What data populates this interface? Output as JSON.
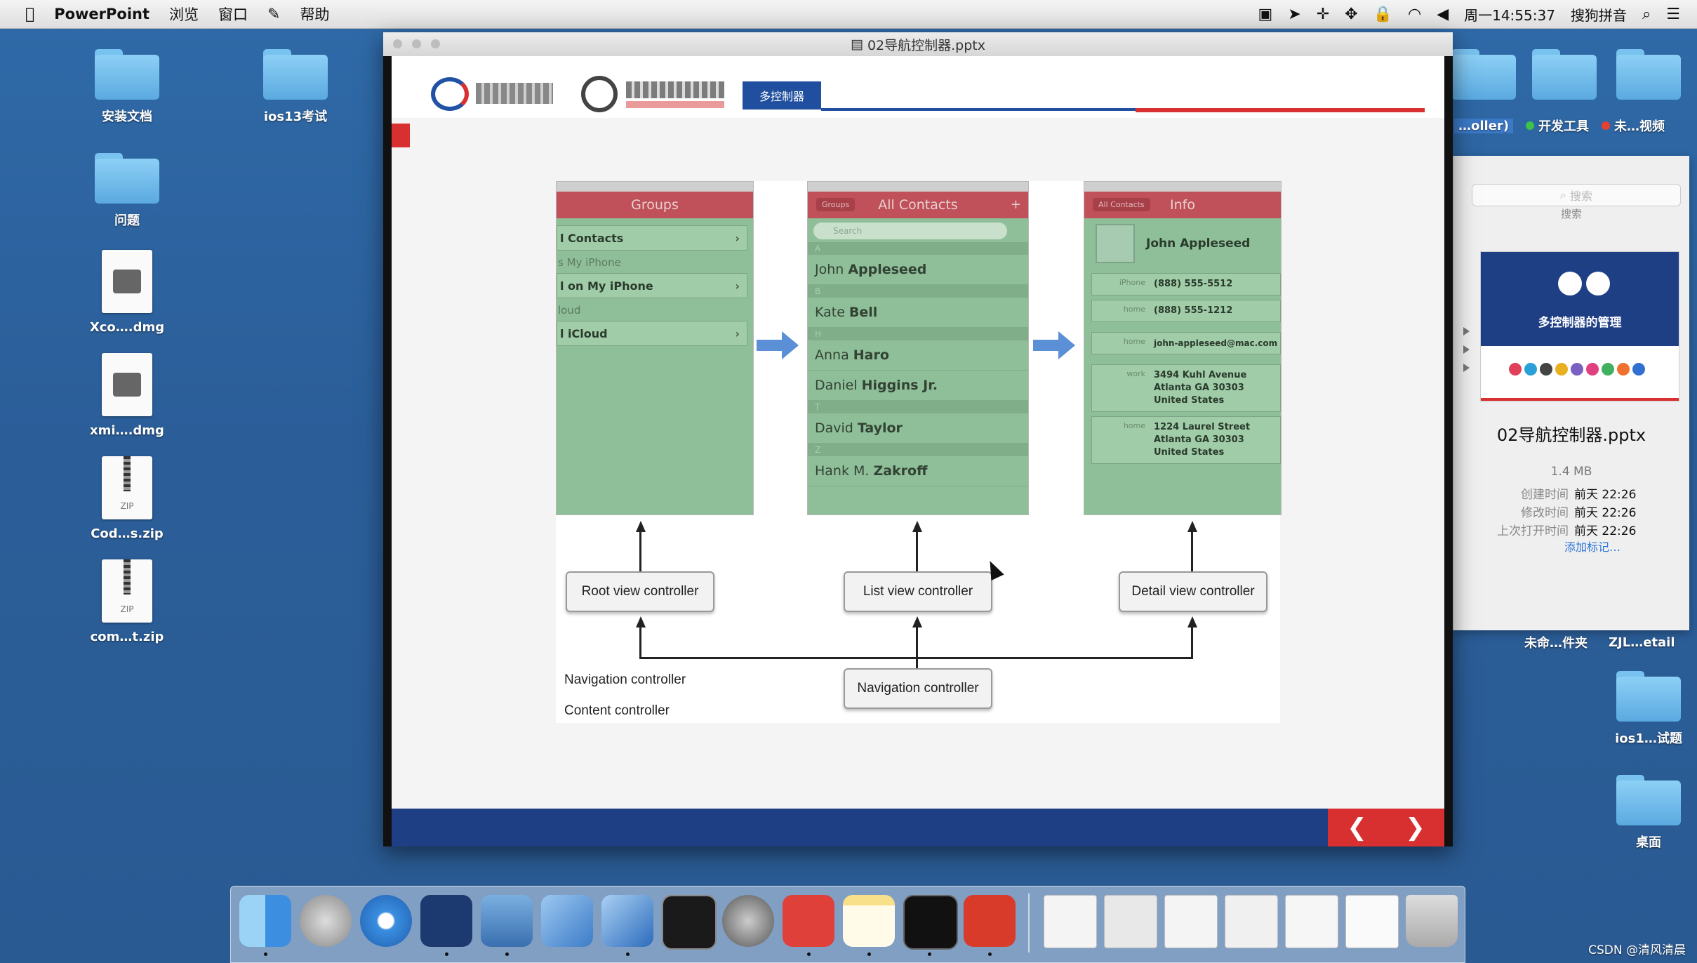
{
  "menubar": {
    "app_name": "PowerPoint",
    "menus": [
      "浏览",
      "窗口",
      "帮助"
    ],
    "clock": "周一14:55:37",
    "input_method": "搜狗拼音"
  },
  "desktop_left": [
    {
      "label": "安装文档",
      "kind": "folder"
    },
    {
      "label": "ios13考试",
      "kind": "folder"
    },
    {
      "label": "问题",
      "kind": "folder"
    },
    {
      "label": "Xco….dmg",
      "kind": "dmg"
    },
    {
      "label": "xmi….dmg",
      "kind": "dmg"
    },
    {
      "label": "Cod…s.zip",
      "kind": "zip"
    },
    {
      "label": "com…t.zip",
      "kind": "zip"
    }
  ],
  "desktop_right": {
    "tag_row": [
      {
        "label": "…oller)",
        "color": ""
      },
      {
        "label": "开发工具",
        "color": "#3dc24a"
      },
      {
        "label": "未…视频",
        "color": "#e8402f"
      }
    ],
    "row2": [
      "未命…件夹",
      "ZJL…etail"
    ],
    "items": [
      {
        "label": "ios1…试题"
      },
      {
        "label": "桌面"
      }
    ]
  },
  "window": {
    "title": "02导航控制器.pptx"
  },
  "slide": {
    "header_badge": "多控制器",
    "zip_text": "ZIP",
    "nav_prev": "❮",
    "nav_next": "❯",
    "groups_screen": {
      "title": "Groups",
      "rows": [
        {
          "type": "row",
          "label": "l Contacts"
        },
        {
          "type": "section",
          "label": "s My iPhone"
        },
        {
          "type": "row",
          "label": "l on My iPhone"
        },
        {
          "type": "section",
          "label": "loud"
        },
        {
          "type": "row",
          "label": "l iCloud"
        }
      ]
    },
    "contacts_screen": {
      "back": "Groups",
      "title": "All Contacts",
      "plus": "+",
      "search_placeholder": "Search",
      "entries": [
        {
          "section": "A"
        },
        {
          "first": "John",
          "last": "Appleseed"
        },
        {
          "section": "B"
        },
        {
          "first": "Kate",
          "last": "Bell"
        },
        {
          "section": "H"
        },
        {
          "first": "Anna",
          "last": "Haro"
        },
        {
          "first": "Daniel",
          "last": "Higgins Jr."
        },
        {
          "section": "T"
        },
        {
          "first": "David",
          "last": "Taylor"
        },
        {
          "section": "Z"
        },
        {
          "first": "Hank M.",
          "last": "Zakroff"
        }
      ]
    },
    "info_screen": {
      "back": "All Contacts",
      "title": "Info",
      "name": "John Appleseed",
      "fields": [
        {
          "label": "iPhone",
          "value": "(888) 555-5512"
        },
        {
          "label": "home",
          "value": "(888) 555-1212"
        },
        {
          "label": "home",
          "value": "john-appleseed@mac.com"
        },
        {
          "label": "work",
          "value": "3494 Kuhl Avenue\nAtlanta GA 30303\nUnited States"
        },
        {
          "label": "home",
          "value": "1224 Laurel Street\nAtlanta GA 30303\nUnited States"
        }
      ]
    },
    "boxes": {
      "root": "Root view controller",
      "list": "List view controller",
      "detail": "Detail view controller",
      "nav": "Navigation controller"
    },
    "legend": {
      "navigation": "Navigation controller",
      "content": "Content controller"
    }
  },
  "finder_panel": {
    "search_placeholder": "搜索",
    "search_caption": "搜索",
    "thumb_title": "多控制器的管理",
    "file_name": "02导航控制器.pptx",
    "size": "1.4 MB",
    "meta": [
      {
        "key": "创建时间",
        "value": "前天 22:26"
      },
      {
        "key": "修改时间",
        "value": "前天 22:26"
      },
      {
        "key": "上次打开时间",
        "value": "前天 22:26"
      }
    ],
    "add_tags": "添加标记…"
  },
  "dock": {
    "apps": [
      "finder-icon",
      "launchpad-icon",
      "safari-icon",
      "mouse-app-icon",
      "keynote-icon",
      "xcode-icon",
      "simulator-icon",
      "terminal-icon",
      "system-preferences-icon",
      "xmind-icon",
      "notes-icon",
      "console-icon",
      "powerpoint-icon"
    ],
    "stack_items": [
      "doc-stack-1",
      "doc-stack-2",
      "doc-stack-3",
      "doc-stack-4",
      "doc-stack-5",
      "doc-stack-6",
      "trash-icon"
    ]
  },
  "watermark": "CSDN @清风清晨"
}
